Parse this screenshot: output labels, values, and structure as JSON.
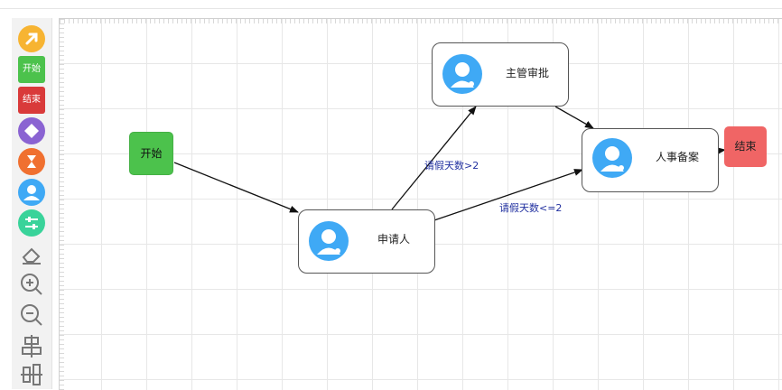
{
  "toolbar": {
    "items": [
      {
        "name": "pointer-tool",
        "icon": "arrow-icon",
        "color": "#f7b432"
      },
      {
        "name": "start-tool",
        "label": "开始",
        "color": "#4cc24c"
      },
      {
        "name": "end-tool",
        "label": "结束",
        "color": "#d93a3a"
      },
      {
        "name": "condition-tool",
        "icon": "diamond-icon",
        "color": "#8a63d2"
      },
      {
        "name": "timer-tool",
        "icon": "hourglass-icon",
        "color": "#f07030"
      },
      {
        "name": "user-task-tool",
        "icon": "user-icon",
        "color": "#3fa9f5"
      },
      {
        "name": "settings-tool",
        "icon": "sliders-icon",
        "color": "#39d39a"
      },
      {
        "name": "eraser-tool",
        "icon": "eraser-icon"
      },
      {
        "name": "zoom-in-tool",
        "icon": "zoom-in-icon"
      },
      {
        "name": "zoom-out-tool",
        "icon": "zoom-out-icon"
      },
      {
        "name": "align-center-tool",
        "icon": "align-center-icon"
      },
      {
        "name": "align-middle-tool",
        "icon": "align-middle-icon"
      }
    ]
  },
  "diagram": {
    "start": {
      "label": "开始",
      "color": "#4cc24c"
    },
    "end": {
      "label": "结束",
      "color": "#f06565"
    },
    "applicant": {
      "label": "申请人"
    },
    "supervisor": {
      "label": "主管审批"
    },
    "hr": {
      "label": "人事备案"
    },
    "edges": {
      "gt2": {
        "label": "请假天数>2"
      },
      "le2": {
        "label": "请假天数<=2"
      }
    }
  }
}
